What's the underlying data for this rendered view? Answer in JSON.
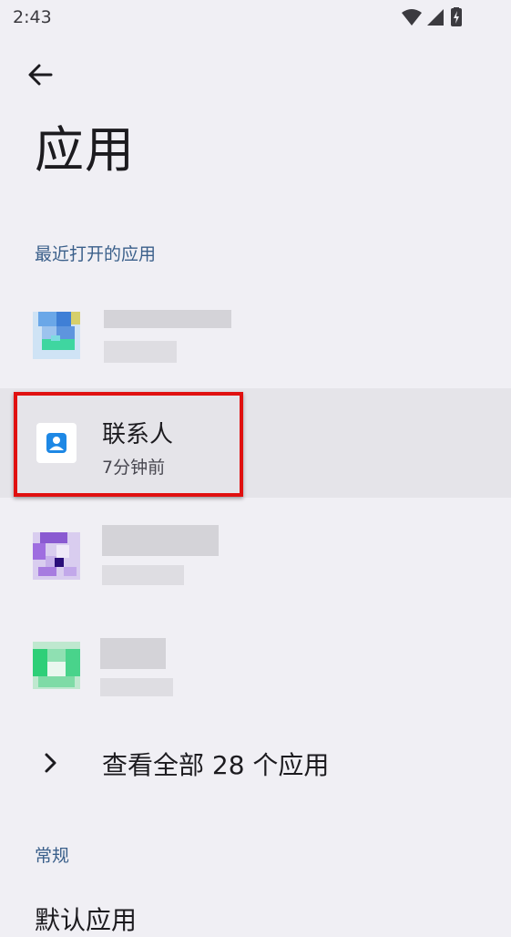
{
  "status_bar": {
    "time": "2:43",
    "icons": [
      "wifi-icon",
      "cell-signal-icon",
      "battery-charging-icon"
    ]
  },
  "header": {
    "back_icon": "arrow-left-icon",
    "title": "应用"
  },
  "recent": {
    "header": "最近打开的应用",
    "apps": [
      {
        "name": "",
        "subtitle": "",
        "icon": "blurred-app-icon",
        "obscured": true
      },
      {
        "name": "联系人",
        "subtitle": "7分钟前",
        "icon": "contacts-icon",
        "highlighted": true
      },
      {
        "name": "",
        "subtitle": "",
        "icon": "blurred-app-icon",
        "obscured": true
      },
      {
        "name": "",
        "subtitle": "",
        "icon": "blurred-app-icon",
        "obscured": true
      }
    ]
  },
  "see_all": {
    "label": "查看全部 28 个应用",
    "icon": "chevron-right-icon"
  },
  "general": {
    "header": "常规",
    "first_item": "默认应用"
  },
  "colors": {
    "background": "#f0eff4",
    "highlight": "#e5e4e9",
    "section_header": "#3a5f8a",
    "annotation": "#e01010"
  }
}
